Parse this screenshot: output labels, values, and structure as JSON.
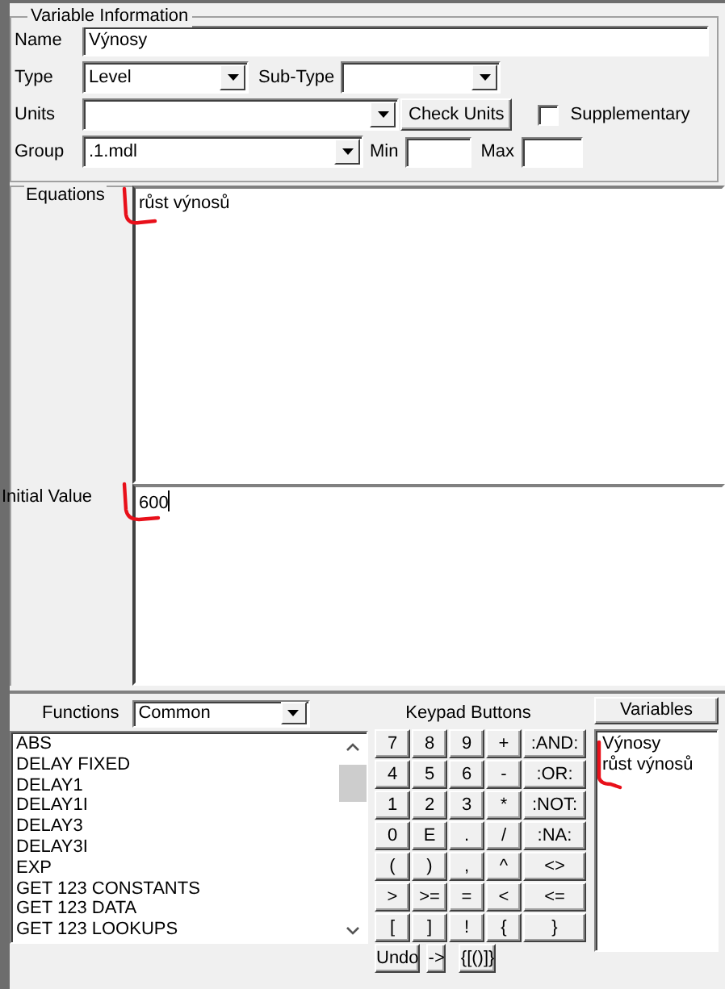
{
  "variable_information": {
    "title": "Variable Information",
    "name": {
      "label": "Name",
      "value": "Výnosy"
    },
    "type": {
      "label": "Type",
      "value": "Level"
    },
    "sub_type": {
      "label": "Sub-Type"
    },
    "units": {
      "label": "Units"
    },
    "check_units_button": "Check Units",
    "supplementary": {
      "label": "Supplementary",
      "checked": false
    },
    "group": {
      "label": "Group",
      "value": ".1.mdl"
    },
    "min": {
      "label": "Min"
    },
    "max": {
      "label": "Max"
    }
  },
  "equations": {
    "label": "Equations",
    "value": "růst výnosů"
  },
  "initial_value": {
    "label": "Initial Value",
    "value": "600"
  },
  "functions": {
    "title": "Functions",
    "category": "Common",
    "items": [
      "ABS",
      "DELAY FIXED",
      "DELAY1",
      "DELAY1I",
      "DELAY3",
      "DELAY3I",
      "EXP",
      "GET 123 CONSTANTS",
      "GET 123 DATA",
      "GET 123 LOOKUPS"
    ]
  },
  "keypad": {
    "title": "Keypad Buttons",
    "rows": [
      [
        "7",
        "8",
        "9",
        "+",
        ":AND:"
      ],
      [
        "4",
        "5",
        "6",
        "-",
        ":OR:"
      ],
      [
        "1",
        "2",
        "3",
        "*",
        ":NOT:"
      ],
      [
        "0",
        "E",
        ".",
        "/",
        ":NA:"
      ],
      [
        "(",
        ")",
        ",",
        "^",
        "<>"
      ],
      [
        ">",
        ">=",
        "=",
        "<",
        "<="
      ],
      [
        "[",
        "]",
        "!",
        "{",
        "}"
      ]
    ],
    "actions": [
      "Undo",
      "->",
      "{[()]}"
    ]
  },
  "variables": {
    "button": "Variables",
    "items": [
      "Výnosy",
      "růst výnosů"
    ]
  }
}
